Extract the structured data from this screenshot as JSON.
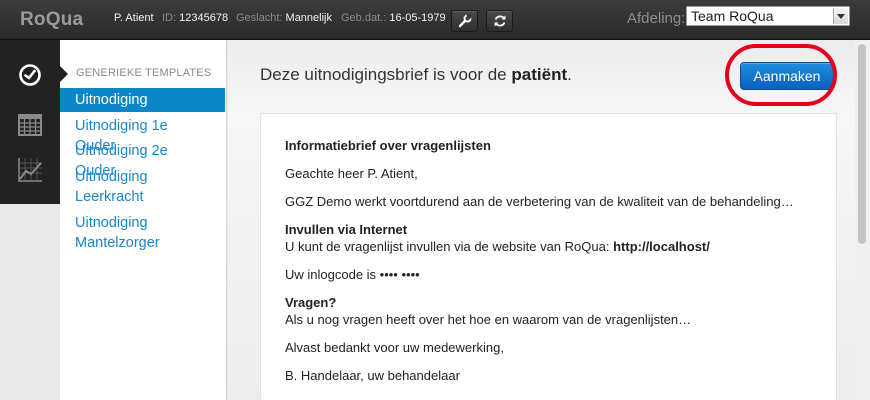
{
  "app": {
    "logo": "RoQua"
  },
  "patient": {
    "name": "P. Atient",
    "id_label": "ID:",
    "id_value": "12345678",
    "gender_label": "Geslacht:",
    "gender_value": "Mannelijk",
    "dob_label": "Geb.dat.:",
    "dob_value": "16-05-1979"
  },
  "toolbar": {
    "edit_icon": "wrench-icon",
    "refresh_icon": "refresh-icon"
  },
  "department": {
    "label": "Afdeling:",
    "selected": "Team RoQua"
  },
  "rail": {
    "items": [
      "dashboard-icon",
      "calendar-icon",
      "chart-icon"
    ]
  },
  "templates": {
    "heading": "GENERIEKE TEMPLATES",
    "items": [
      {
        "line1": "Uitnodiging",
        "line2": "",
        "active": true
      },
      {
        "line1": "Uitnodiging 1e Ouder",
        "line2": "",
        "active": false
      },
      {
        "line1": "Uitnodiging 2e Ouder",
        "line2": "",
        "active": false
      },
      {
        "line1": "Uitnodiging",
        "line2": "Leerkracht",
        "active": false
      },
      {
        "line1": "Uitnodiging",
        "line2": "Mantelzorger",
        "active": false
      }
    ]
  },
  "main": {
    "heading_prefix": "Deze uitnodigingsbrief is voor de",
    "heading_strong": "patiënt",
    "heading_suffix": ".",
    "create_button": "Aanmaken"
  },
  "letter": {
    "title": "Informatiebrief over vragenlijsten",
    "greeting": "Geachte heer P. Atient,",
    "intro": "GGZ Demo werkt voortdurend aan de verbetering van de kwaliteit van de behandeling…",
    "internet_heading": "Invullen via Internet",
    "internet_text": "U kunt de vragenlijst invullen via de website van RoQua:",
    "internet_url": "http://localhost/",
    "login_text": "Uw inlogcode is •••• ••••",
    "questions_heading": "Vragen?",
    "questions_text": "Als u nog vragen heeft over het hoe en waarom van de vragenlijsten…",
    "thanks": "Alvast bedankt voor uw medewerking,",
    "signature": "B. Handelaar, uw behandelaar"
  },
  "colors": {
    "accent": "#0a87c9",
    "link": "#1a86c8",
    "highlight": "#e4001b",
    "button": "#1473d0"
  }
}
